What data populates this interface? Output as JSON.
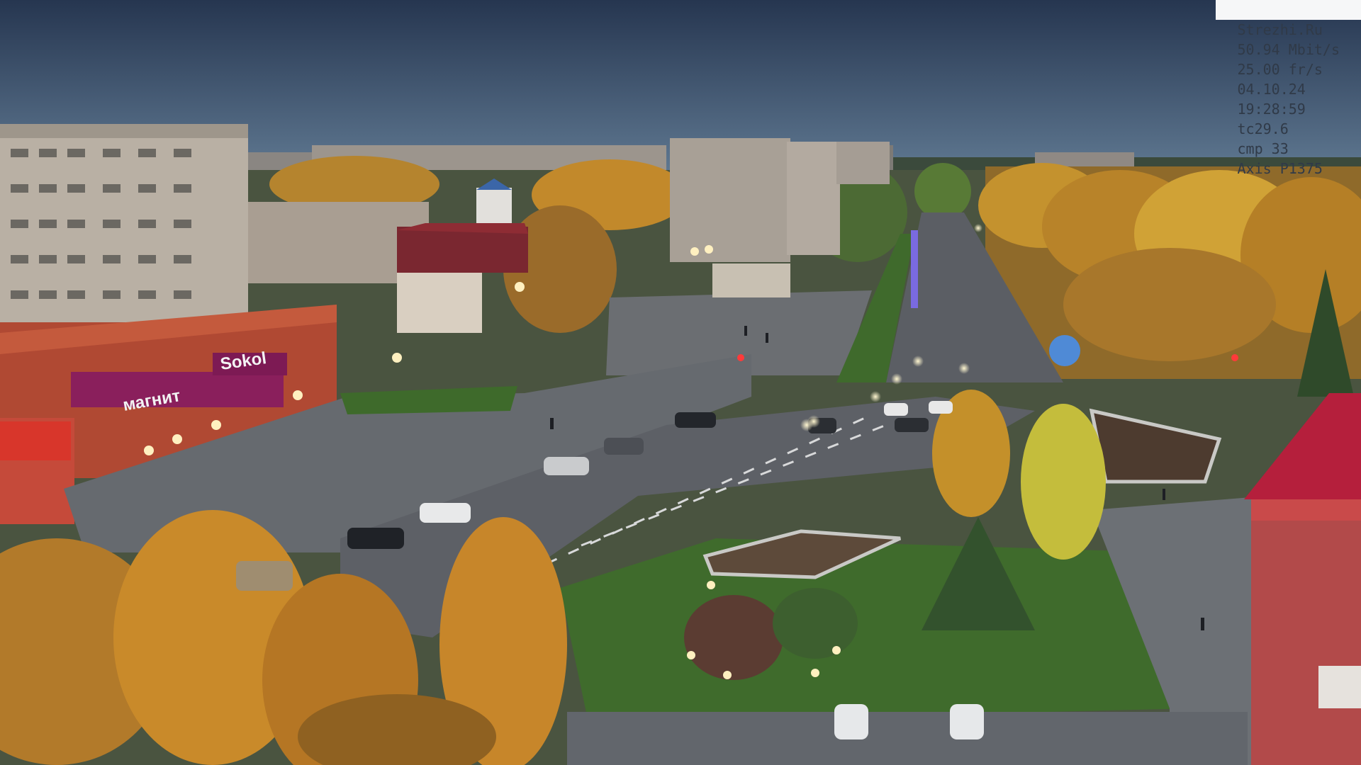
{
  "camera_overlay": {
    "site": "Strezhi.Ru",
    "bitrate": "50.94 Mbit/s",
    "framerate": "25.00 fr/s",
    "date": "04.10.24",
    "time": "19:28:59",
    "tc": "tc29.6",
    "cmp": "cmp 33",
    "model": "Axis P1375"
  },
  "store_signs": {
    "magnit": "магнит",
    "sokol": "Sokol"
  },
  "colors": {
    "sky_top": "#2a3b57",
    "sky_bottom": "#5c7590",
    "foliage_orange": "#c98a2a",
    "foliage_yellow": "#d7b23a",
    "grass": "#3f6a2c",
    "asphalt": "#5d6066",
    "brick_red": "#b24a36",
    "sign_magenta": "#8a1f5c",
    "street_light": "#ffe9a8"
  }
}
